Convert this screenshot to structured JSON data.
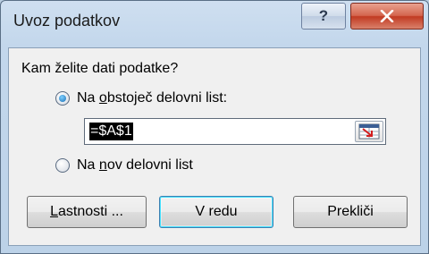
{
  "window": {
    "title": "Uvoz podatkov",
    "help_glyph": "?",
    "close_icon": "close-icon"
  },
  "form": {
    "prompt": "Kam želite dati podatke?",
    "option_existing": {
      "prefix": "Na ",
      "accel": "o",
      "rest": "bstoječ delovni list:",
      "checked": true
    },
    "reference_value": "=$A$1",
    "option_new": {
      "prefix": "Na ",
      "accel": "n",
      "rest": "ov delovni list",
      "checked": false
    }
  },
  "buttons": {
    "properties": {
      "accel": "L",
      "rest": "astnosti ..."
    },
    "ok": "V redu",
    "cancel": "Prekliči"
  },
  "colors": {
    "close_button": "#c13a22",
    "radio_selected": "#1a6fb5",
    "default_button_border": "#3c7fb1"
  }
}
